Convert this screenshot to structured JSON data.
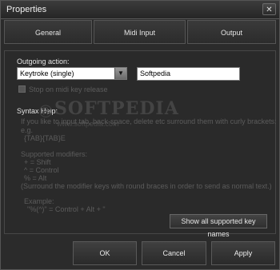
{
  "window": {
    "title": "Properties"
  },
  "tabs": [
    {
      "label": "General"
    },
    {
      "label": "Midi Input"
    },
    {
      "label": "Output"
    }
  ],
  "outgoing": {
    "label": "Outgoing action:",
    "select_value": "Keytroke (single)",
    "input_value": "Softpedia",
    "checkbox_label": "Stop on midi key release",
    "checkbox_checked": false
  },
  "syntax_help": {
    "title": "Syntax Help:",
    "lines": [
      "If you like to input tab, back-space, delete etc surround them with curly brackets:",
      "e.g.",
      "{TAB}{TAB}E",
      "",
      "Supported modifiers:",
      "+ = Shift",
      "^ = Control",
      "% = Alt",
      "(Surround the modifier keys with round braces in order to send as normal text.)",
      "",
      "Example:",
      "\"%(^)\" = Control + Alt + \""
    ]
  },
  "watermark": {
    "text": "SOFTPEDIA",
    "url": "www.softpedia.com",
    "mark": "®"
  },
  "buttons": {
    "show_keys": "Show all supported key names",
    "ok": "OK",
    "cancel": "Cancel",
    "apply": "Apply"
  }
}
